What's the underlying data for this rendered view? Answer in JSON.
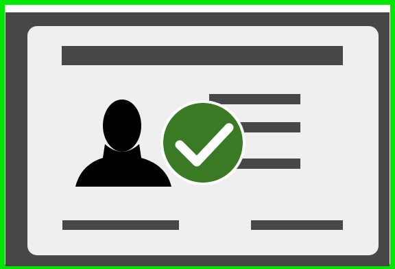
{
  "icon": {
    "name": "verified-id-card-icon",
    "parts": [
      "id-card",
      "person-silhouette-icon",
      "checkmark-badge-icon",
      "text-lines"
    ]
  },
  "colors": {
    "outer_border": "#00e600",
    "card_border": "#474747",
    "card_face": "#efefef",
    "text_bars": "#474747",
    "silhouette": "#000000",
    "badge_fill": "#3a7a25",
    "badge_ring": "#ffffff",
    "check_mark": "#ffffff"
  }
}
